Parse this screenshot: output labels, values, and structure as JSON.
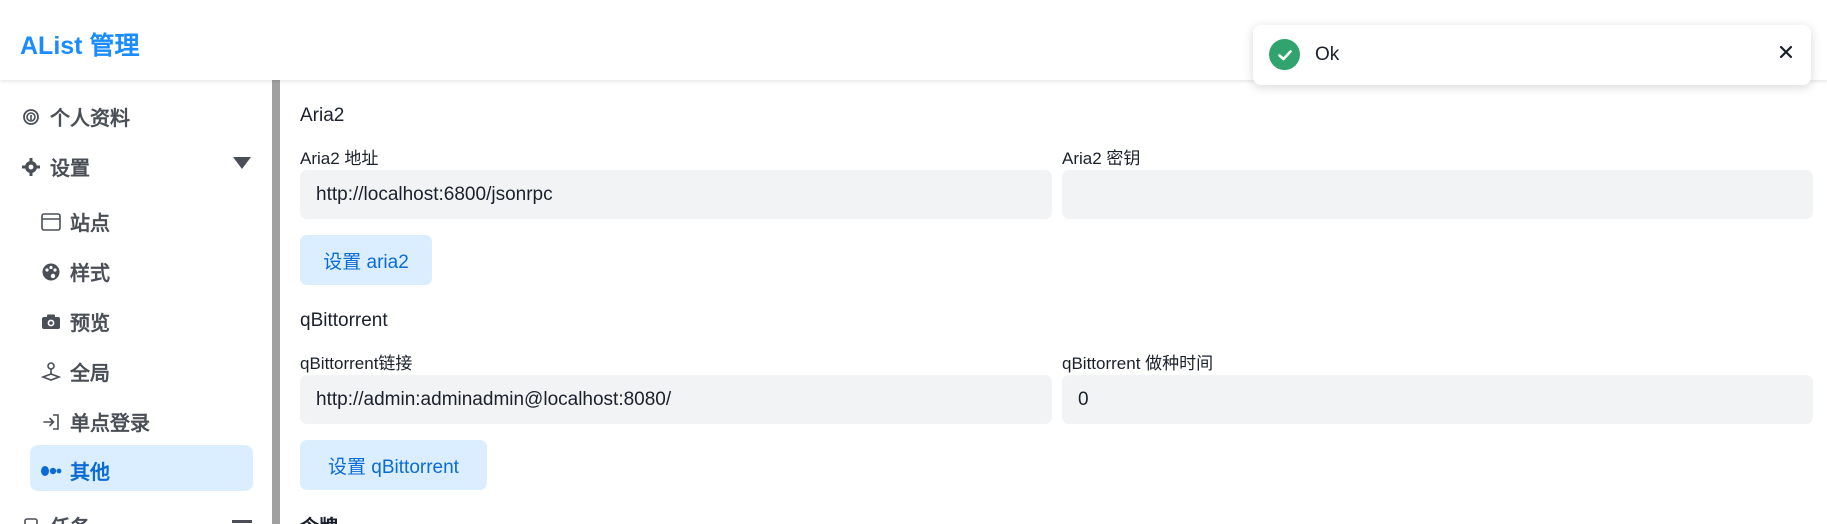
{
  "header": {
    "title": "AList 管理"
  },
  "toast": {
    "message": "Ok",
    "icon": "check-circle-icon",
    "close_icon": "close-icon"
  },
  "sidebar": {
    "items": [
      {
        "label": "个人资料",
        "icon": "fingerprint-icon"
      },
      {
        "label": "设置",
        "icon": "gear-icon",
        "expanded": true
      },
      {
        "label": "站点",
        "icon": "window-icon"
      },
      {
        "label": "样式",
        "icon": "palette-icon"
      },
      {
        "label": "预览",
        "icon": "camera-icon"
      },
      {
        "label": "全局",
        "icon": "joystick-icon"
      },
      {
        "label": "单点登录",
        "icon": "sign-in-icon"
      },
      {
        "label": "其他",
        "icon": "dots-icon",
        "active": true
      },
      {
        "label": "任务",
        "icon": "tasks-icon"
      }
    ]
  },
  "main": {
    "aria2": {
      "title": "Aria2",
      "uri_label": "Aria2 地址",
      "uri_value": "http://localhost:6800/jsonrpc",
      "secret_label": "Aria2 密钥",
      "secret_value": "",
      "button": "设置 aria2"
    },
    "qbittorrent": {
      "title": "qBittorrent",
      "url_label": "qBittorrent链接",
      "url_value": "http://admin:adminadmin@localhost:8080/",
      "seedtime_label": "qBittorrent 做种时间",
      "seedtime_value": "0",
      "button": "设置 qBittorrent"
    },
    "next_section_title": "令牌"
  },
  "colors": {
    "accent": "#1a8cff",
    "active_bg": "#dbeeff",
    "active_text": "#0a6bd6",
    "success": "#30a46c"
  }
}
